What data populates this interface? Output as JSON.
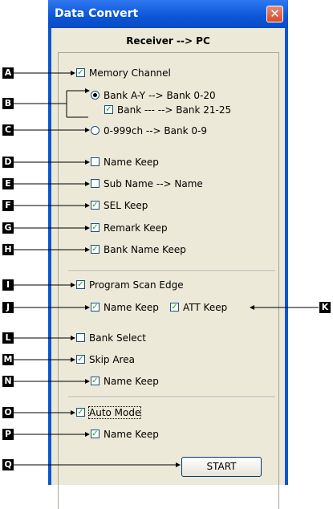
{
  "window": {
    "title": "Data Convert",
    "close_glyph": "✕"
  },
  "header": {
    "text": "Receiver --> PC"
  },
  "options": {
    "memory_channel": {
      "label": "Memory Channel",
      "checked": true
    },
    "bank_az": {
      "label": "Bank A-Y  -->  Bank 0-20",
      "selected": true
    },
    "bank_blank": {
      "label": "Bank ---   -->  Bank 21-25",
      "checked": true
    },
    "ch_999": {
      "label": "0-999ch  -->  Bank 0-9",
      "selected": false
    },
    "name_keep": {
      "label": "Name Keep",
      "checked": false
    },
    "sub_name": {
      "label": "Sub Name  -->  Name",
      "checked": false
    },
    "sel_keep": {
      "label": "SEL Keep",
      "checked": true
    },
    "remark_keep": {
      "label": "Remark Keep",
      "checked": true
    },
    "bank_name_keep": {
      "label": "Bank Name Keep",
      "checked": true
    },
    "program_scan_edge": {
      "label": "Program Scan Edge",
      "checked": true
    },
    "pse_name_keep": {
      "label": "Name Keep",
      "checked": true
    },
    "att_keep": {
      "label": "ATT Keep",
      "checked": true
    },
    "bank_select": {
      "label": "Bank Select",
      "checked": false
    },
    "skip_area": {
      "label": "Skip Area",
      "checked": true
    },
    "skip_name_keep": {
      "label": "Name Keep",
      "checked": true
    },
    "auto_mode": {
      "label": "Auto Mode",
      "checked": true
    },
    "auto_name_keep": {
      "label": "Name Keep",
      "checked": true
    }
  },
  "start_button": {
    "label": "START"
  },
  "callouts": [
    "A",
    "B",
    "C",
    "D",
    "E",
    "F",
    "G",
    "H",
    "I",
    "J",
    "K",
    "L",
    "M",
    "N",
    "O",
    "P",
    "Q"
  ],
  "check_glyph": "✓",
  "colors": {
    "titlebar": "#0b55d8",
    "dialog_bg": "#ece9d8",
    "close": "#d54b2b",
    "check": "#21a121"
  }
}
